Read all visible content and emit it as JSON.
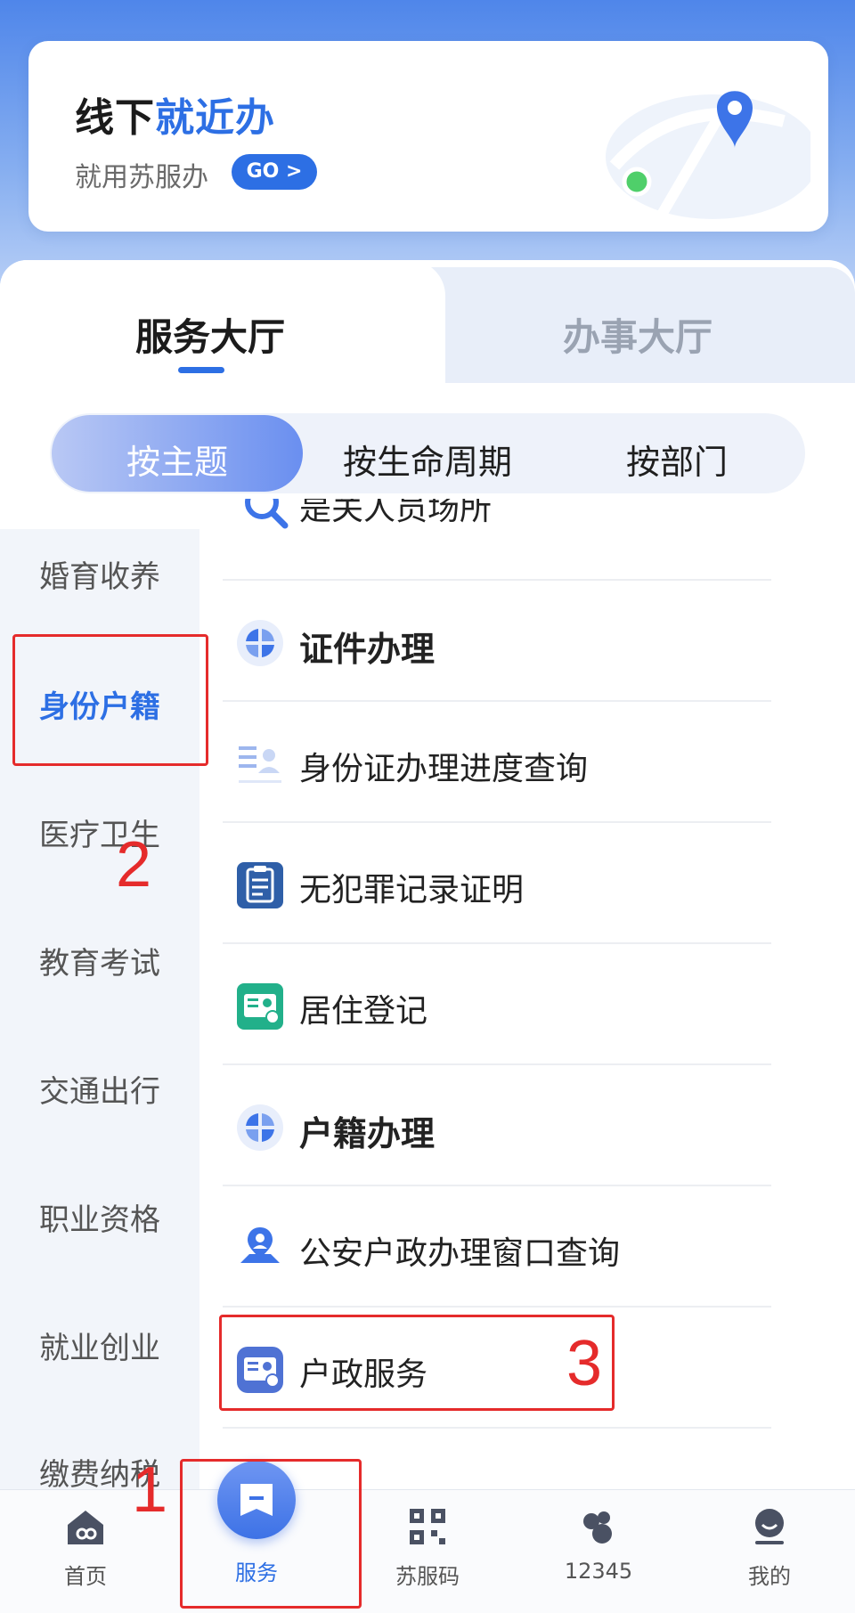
{
  "banner": {
    "title_part1": "线下",
    "title_part2": "就近办",
    "subtitle": "就用苏服办",
    "go_label": "GO >"
  },
  "tabs": [
    {
      "label": "服务大厅",
      "active": true
    },
    {
      "label": "办事大厅",
      "active": false
    }
  ],
  "segments": [
    {
      "label": "按主题",
      "active": true
    },
    {
      "label": "按生命周期",
      "active": false
    },
    {
      "label": "按部门",
      "active": false
    }
  ],
  "sidebar": {
    "items": [
      {
        "label": "婚育收养"
      },
      {
        "label": "身份户籍",
        "active": true
      },
      {
        "label": "医疗卫生"
      },
      {
        "label": "教育考试"
      },
      {
        "label": "交通出行"
      },
      {
        "label": "职业资格"
      },
      {
        "label": "就业创业"
      },
      {
        "label": "缴费纳税"
      }
    ]
  },
  "list": {
    "partial_label": "是关人员场所",
    "items": [
      {
        "label": "证件办理",
        "type": "section",
        "icon": "category-icon"
      },
      {
        "label": "身份证办理进度查询",
        "type": "item",
        "icon": "id-card-progress-icon"
      },
      {
        "label": "无犯罪记录证明",
        "type": "item",
        "icon": "document-icon"
      },
      {
        "label": "居住登记",
        "type": "item",
        "icon": "residence-card-icon"
      },
      {
        "label": "户籍办理",
        "type": "section",
        "icon": "category-icon"
      },
      {
        "label": "公安户政办理窗口查询",
        "type": "item",
        "icon": "location-person-icon"
      },
      {
        "label": "户政服务",
        "type": "item",
        "icon": "household-service-icon"
      }
    ]
  },
  "annotations": {
    "n1": "1",
    "n2": "2",
    "n3": "3"
  },
  "navbar": {
    "items": [
      {
        "label": "首页",
        "icon": "home-icon"
      },
      {
        "label": "服务",
        "icon": "service-icon",
        "active": true
      },
      {
        "label": "苏服码",
        "icon": "qr-code-icon"
      },
      {
        "label": "12345",
        "icon": "hotline-icon"
      },
      {
        "label": "我的",
        "icon": "profile-icon"
      }
    ]
  },
  "colors": {
    "accent": "#2d6fe4",
    "annotation": "#e52b2b"
  }
}
